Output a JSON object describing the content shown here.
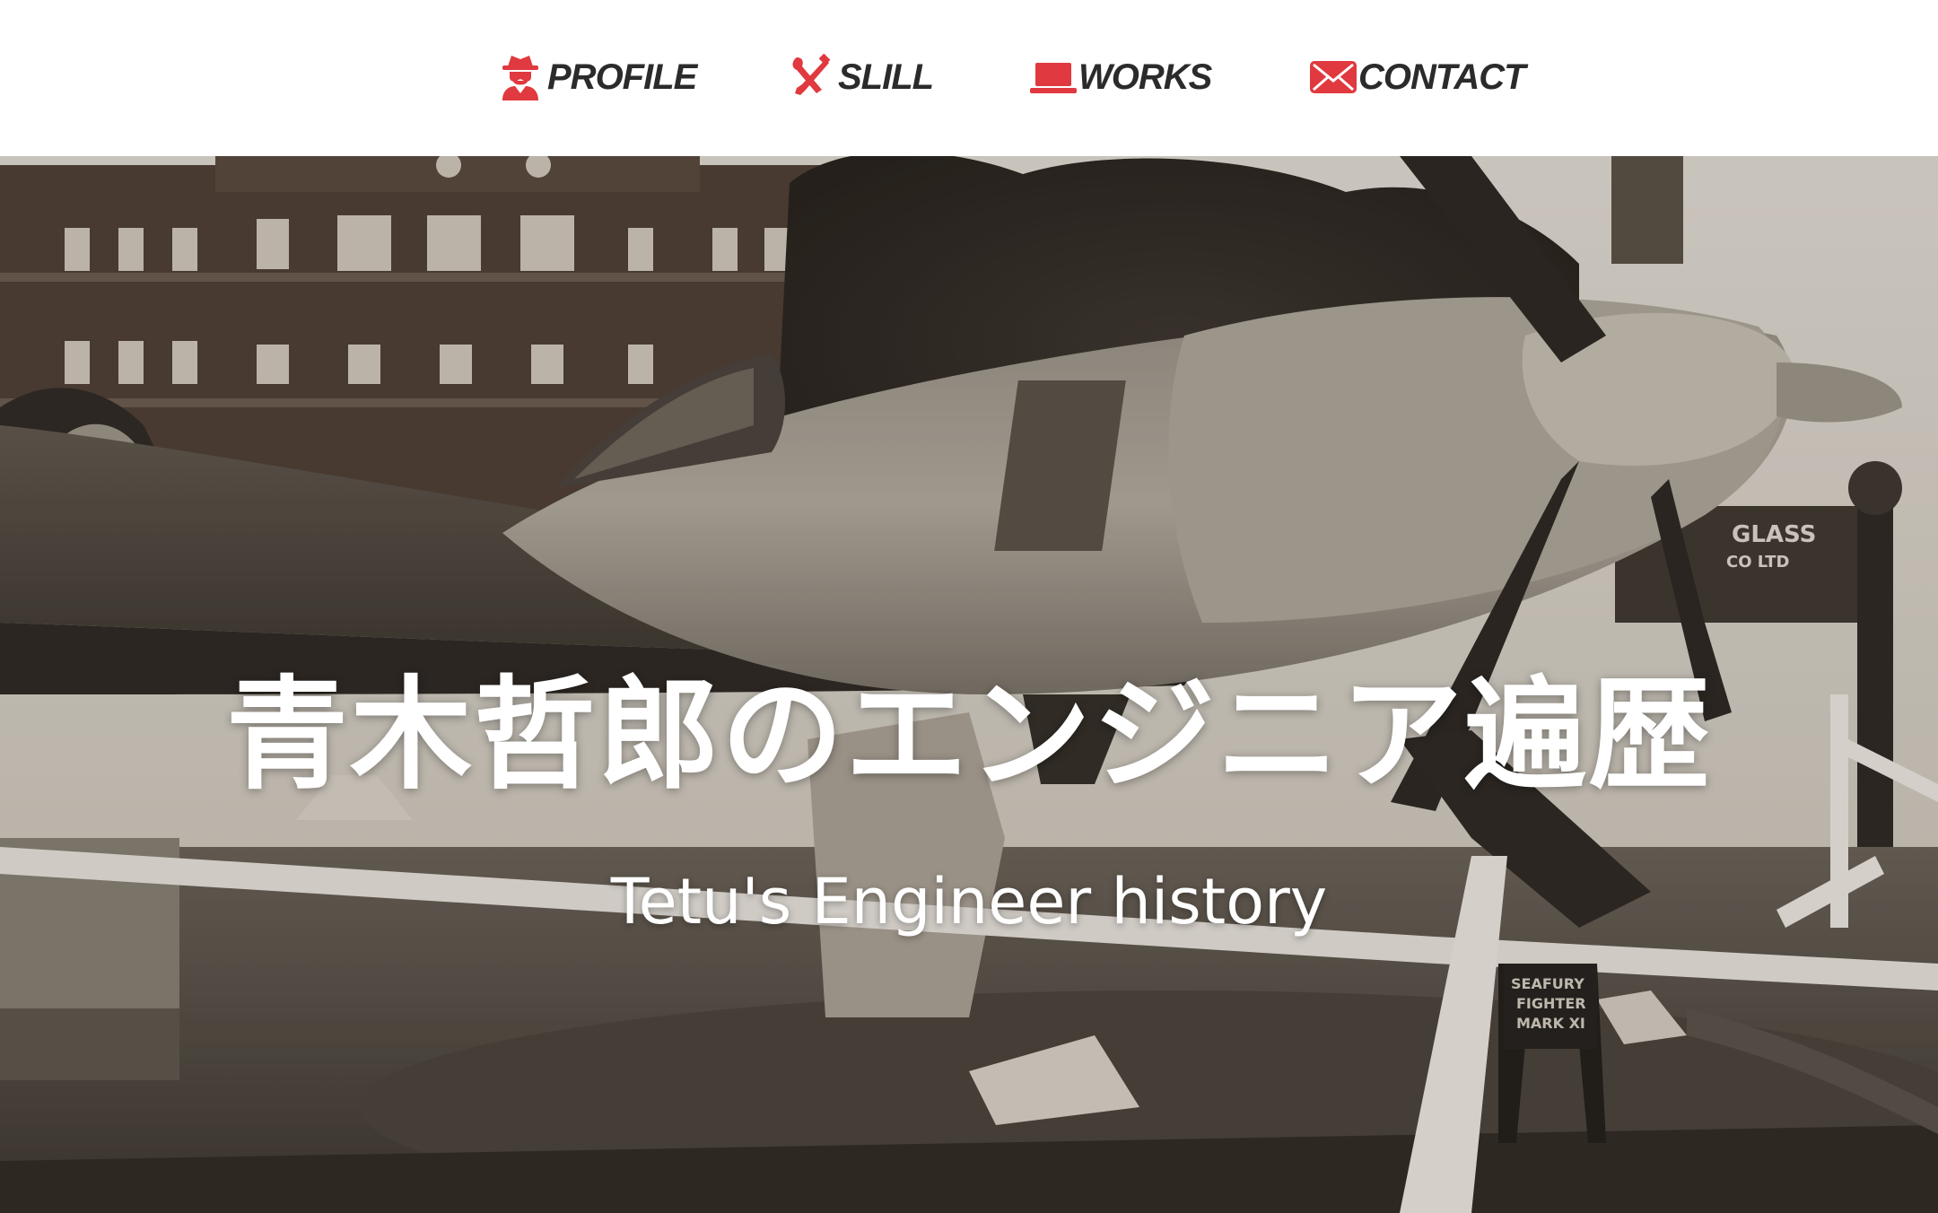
{
  "nav": {
    "items": [
      {
        "label": "PROFILE",
        "icon": "spy-icon"
      },
      {
        "label": "SLILL",
        "icon": "tools-icon"
      },
      {
        "label": "WORKS",
        "icon": "laptop-icon"
      },
      {
        "label": "CONTACT",
        "icon": "envelope-icon"
      }
    ]
  },
  "hero": {
    "title": "青木哲郎のエンジニア遍歴",
    "subtitle": "Tetu's Engineer history",
    "image_sign": {
      "shop": "GLASS",
      "shop2": "CO LTD",
      "plaque_line1": "SEAFURY",
      "plaque_line2": "FIGHTER",
      "plaque_line3": "MARK XI"
    }
  },
  "colors": {
    "accent": "#e0393f",
    "nav_text": "#2b2b2b",
    "hero_text": "#ffffff"
  }
}
